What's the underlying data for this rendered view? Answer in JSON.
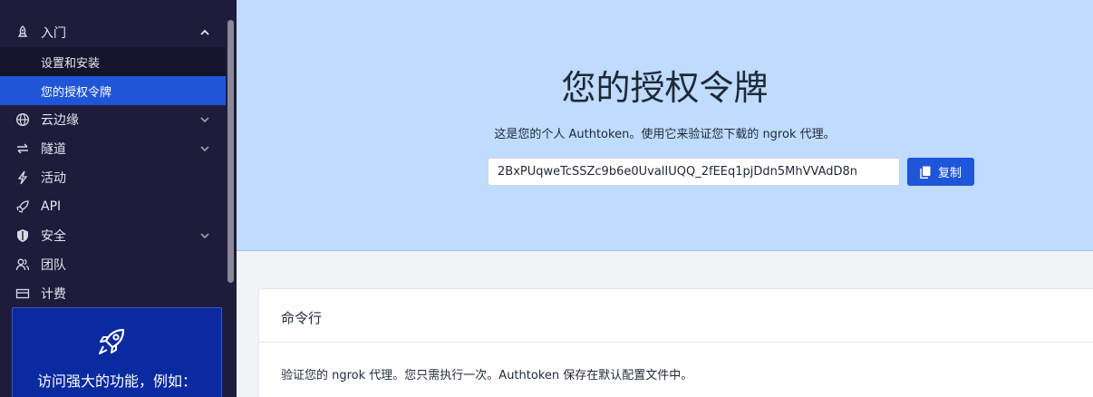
{
  "sidebar": {
    "items": [
      {
        "label": "入门",
        "icon": "rocket-icon",
        "expanded": true
      },
      {
        "label": "云边缘",
        "icon": "globe-icon"
      },
      {
        "label": "隧道",
        "icon": "arrows-icon"
      },
      {
        "label": "活动",
        "icon": "lightning-icon"
      },
      {
        "label": "API",
        "icon": "rocket-small-icon"
      },
      {
        "label": "安全",
        "icon": "shield-icon"
      },
      {
        "label": "团队",
        "icon": "users-icon"
      },
      {
        "label": "计费",
        "icon": "card-icon"
      }
    ],
    "sub_items": [
      {
        "label": "设置和安装",
        "active": false
      },
      {
        "label": "您的授权令牌",
        "active": true
      }
    ],
    "promo": {
      "text": "访问强大的功能，例如："
    }
  },
  "hero": {
    "title": "您的授权令牌",
    "description": "这是您的个人 Authtoken。使用它来验证您下载的 ngrok 代理。",
    "token": "2BxPUqweTcSSZc9b6e0UvalIUQQ_2fEEq1pjDdn5MhVVAdD8n",
    "copy_label": "复制"
  },
  "card": {
    "title": "命令行",
    "text": "验证您的 ngrok 代理。您只需执行一次。Authtoken 保存在默认配置文件中。"
  },
  "colors": {
    "sidebar_bg": "#1e1b3b",
    "accent": "#1f56d8",
    "hero_bg": "#bfdbfe"
  }
}
